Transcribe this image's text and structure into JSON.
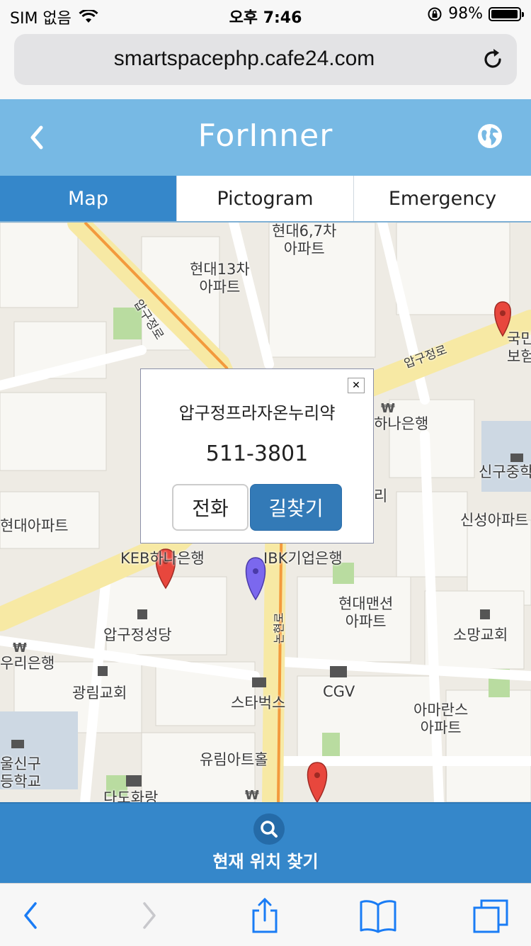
{
  "status_bar": {
    "carrier": "SIM 없음",
    "time": "오후 7:46",
    "battery_percent": "98%",
    "battery_level": 0.98
  },
  "browser": {
    "url": "smartspacephp.cafe24.com"
  },
  "header": {
    "title": "ForInner"
  },
  "tabs": [
    {
      "label": "Map",
      "active": true
    },
    {
      "label": "Pictogram",
      "active": false
    },
    {
      "label": "Emergency",
      "active": false
    }
  ],
  "map": {
    "labels": [
      "현대6,7차\n아파트",
      "현대13차\n아파트",
      "압구정로",
      "압구정로",
      "국민\n보험",
      "하나은행",
      "신구중학",
      "리",
      "신성아파트",
      "현대아파트",
      "KEB하나은행",
      "IBK기업은행",
      "현대맨션\n아파트",
      "압구정성당",
      "소망교회",
      "우리은행",
      "광림교회",
      "스타벅스",
      "CGV",
      "아마란스\n아파트",
      "울신구\n등학교",
      "유림아트홀",
      "논현로",
      "다도화랑",
      "압구정로"
    ],
    "colors": {
      "marker_red": "#e8473d",
      "marker_purple": "#7b68ee",
      "road_yellow": "#f7e9a4",
      "road_orange": "#f39a3d"
    }
  },
  "popup": {
    "name": "압구정프라자온누리약",
    "phone": "511-3801",
    "call_label": "전화",
    "route_label": "길찾기"
  },
  "locate": {
    "label": "현재 위치 찾기"
  }
}
